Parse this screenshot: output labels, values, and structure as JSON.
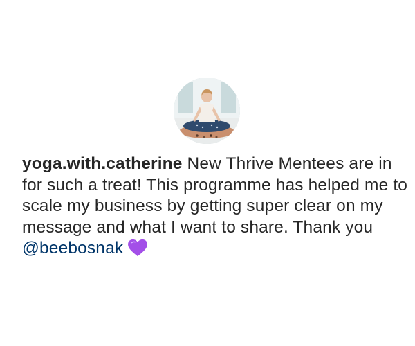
{
  "post": {
    "avatar_icon": "profile-photo",
    "username": "yoga.with.catherine",
    "comment_text": "New Thrive Mentees are in for such a treat! This programme has helped me to scale my business by getting super clear on my message and what I want to share. Thank you ",
    "mention": "@beebosnak",
    "emoji_icon": "purple-heart-icon",
    "colors": {
      "text": "#262626",
      "mention": "#003569",
      "heart": "#a34fe8"
    }
  }
}
